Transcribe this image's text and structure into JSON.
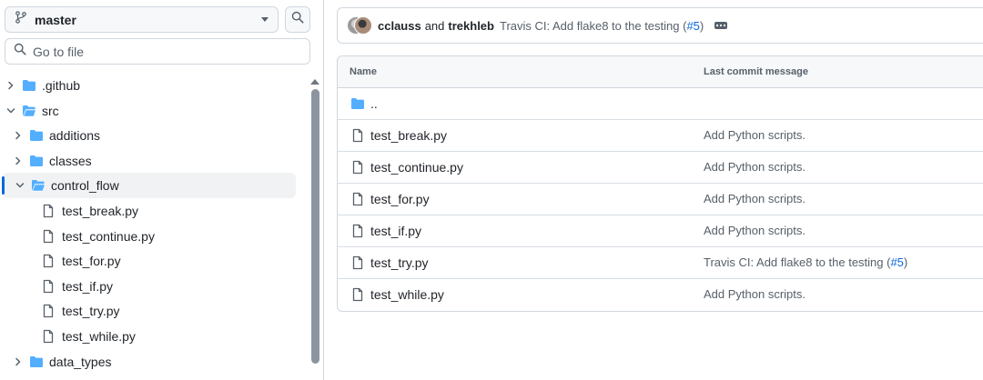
{
  "sidebar": {
    "branch_label": "master",
    "branch_icon": "git-branch-icon",
    "goto_placeholder": "Go to file",
    "tree": [
      {
        "label": ".github",
        "kind": "folder",
        "expanded": false,
        "depth": 0
      },
      {
        "label": "src",
        "kind": "folder",
        "expanded": true,
        "depth": 0
      },
      {
        "label": "additions",
        "kind": "folder",
        "expanded": false,
        "depth": 1
      },
      {
        "label": "classes",
        "kind": "folder",
        "expanded": false,
        "depth": 1
      },
      {
        "label": "control_flow",
        "kind": "folder",
        "expanded": true,
        "depth": 1,
        "active": true
      },
      {
        "label": "test_break.py",
        "kind": "file",
        "depth": 2
      },
      {
        "label": "test_continue.py",
        "kind": "file",
        "depth": 2
      },
      {
        "label": "test_for.py",
        "kind": "file",
        "depth": 2
      },
      {
        "label": "test_if.py",
        "kind": "file",
        "depth": 2
      },
      {
        "label": "test_try.py",
        "kind": "file",
        "depth": 2
      },
      {
        "label": "test_while.py",
        "kind": "file",
        "depth": 2
      },
      {
        "label": "data_types",
        "kind": "folder",
        "expanded": false,
        "depth": 1
      }
    ]
  },
  "commit": {
    "author1": "cclauss",
    "and_text": "and",
    "author2": "trekhleb",
    "message_prefix": "Travis CI: Add flake8 to the testing (",
    "message_link": "#5",
    "message_suffix": ")"
  },
  "table": {
    "col_name": "Name",
    "col_commit": "Last commit message",
    "parent_label": "..",
    "rows": [
      {
        "name": "test_break.py",
        "commit": "Add Python scripts."
      },
      {
        "name": "test_continue.py",
        "commit": "Add Python scripts."
      },
      {
        "name": "test_for.py",
        "commit": "Add Python scripts."
      },
      {
        "name": "test_if.py",
        "commit": "Add Python scripts."
      },
      {
        "name": "test_try.py",
        "commit_prefix": "Travis CI: Add flake8 to the testing (",
        "commit_link": "#5",
        "commit_suffix": ")"
      },
      {
        "name": "test_while.py",
        "commit": "Add Python scripts."
      }
    ]
  },
  "colors": {
    "folder": "#54aeff",
    "accent": "#0969da",
    "border": "#d0d7de",
    "muted_text": "#57606a"
  }
}
